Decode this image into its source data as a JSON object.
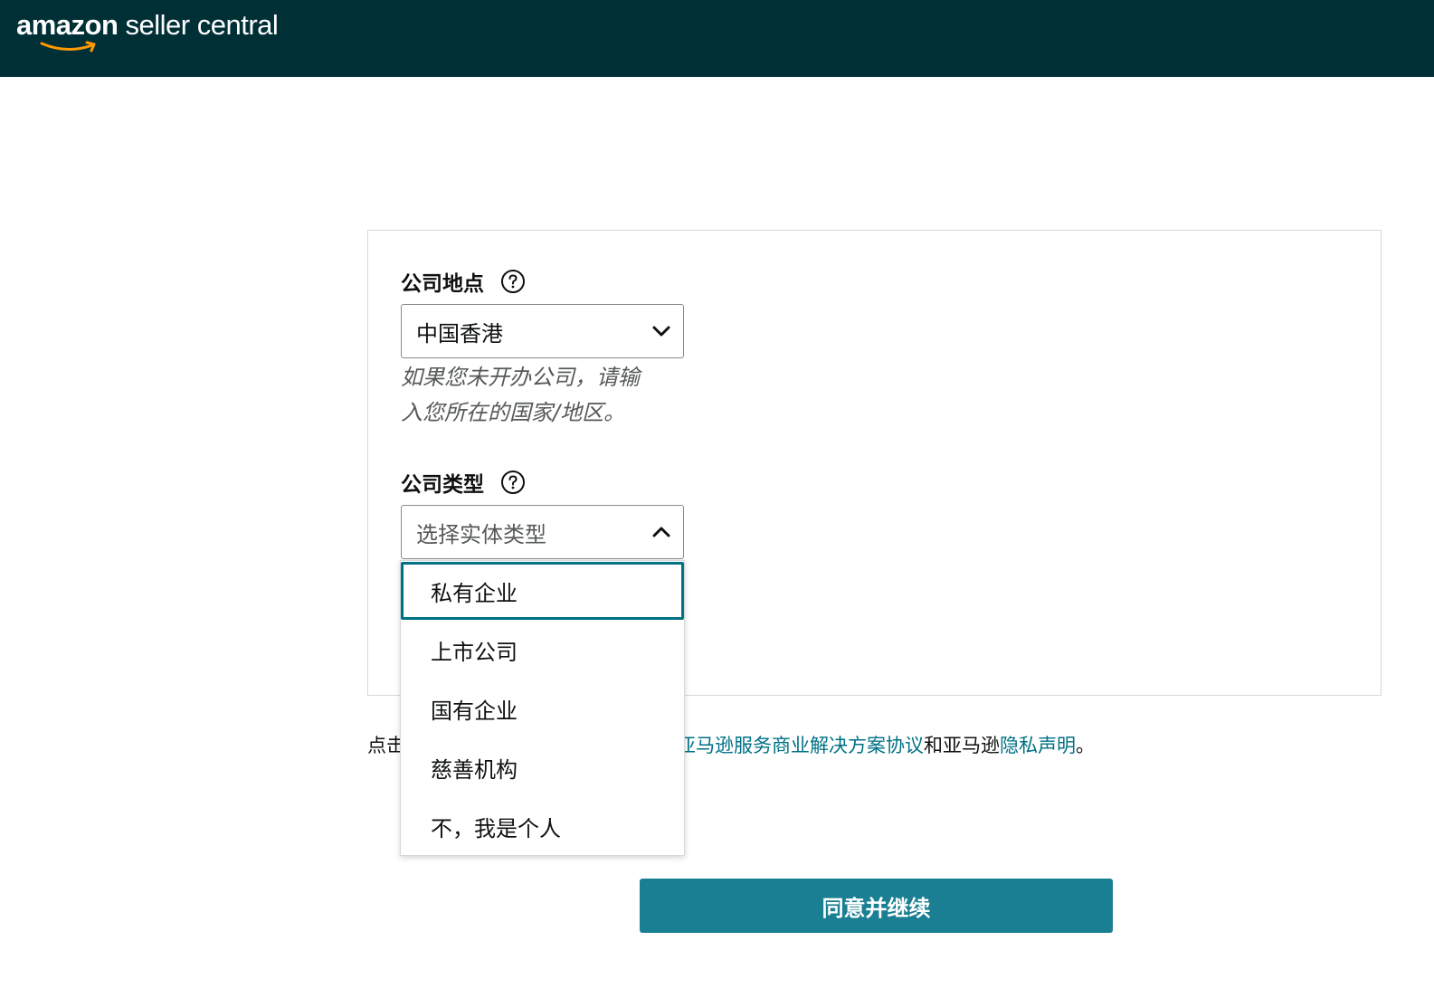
{
  "header": {
    "logo_brand": "amazon",
    "logo_suffix": " seller central",
    "logo_icon": "amazon-smile-icon"
  },
  "form": {
    "location": {
      "label": "公司地点",
      "help_icon": "question-circle-icon",
      "selected_value": "中国香港",
      "chevron_icon": "chevron-down-icon",
      "hint_line1": "如果您未开办公司，请输",
      "hint_line2": "入您所在的国家/地区。"
    },
    "company_type": {
      "label": "公司类型",
      "help_icon": "question-circle-icon",
      "placeholder": "选择实体类型",
      "chevron_icon": "chevron-up-icon",
      "options": [
        {
          "label": "私有企业",
          "highlighted": true
        },
        {
          "label": "上市公司",
          "highlighted": false
        },
        {
          "label": "国有企业",
          "highlighted": false
        },
        {
          "label": "慈善机构",
          "highlighted": false
        },
        {
          "label": "不，我是个人",
          "highlighted": false
        }
      ]
    }
  },
  "agreement": {
    "prefix_visible": "点击",
    "link_agreement": "亚马逊服务商业解决方案协议",
    "joiner": "和亚马逊",
    "link_privacy": "隐私声明",
    "suffix": "。"
  },
  "submit": {
    "label": "同意并继续"
  },
  "colors": {
    "header_bg": "#002f36",
    "button_bg": "#1a7f92",
    "link": "#007185",
    "focus_border": "#007185"
  }
}
